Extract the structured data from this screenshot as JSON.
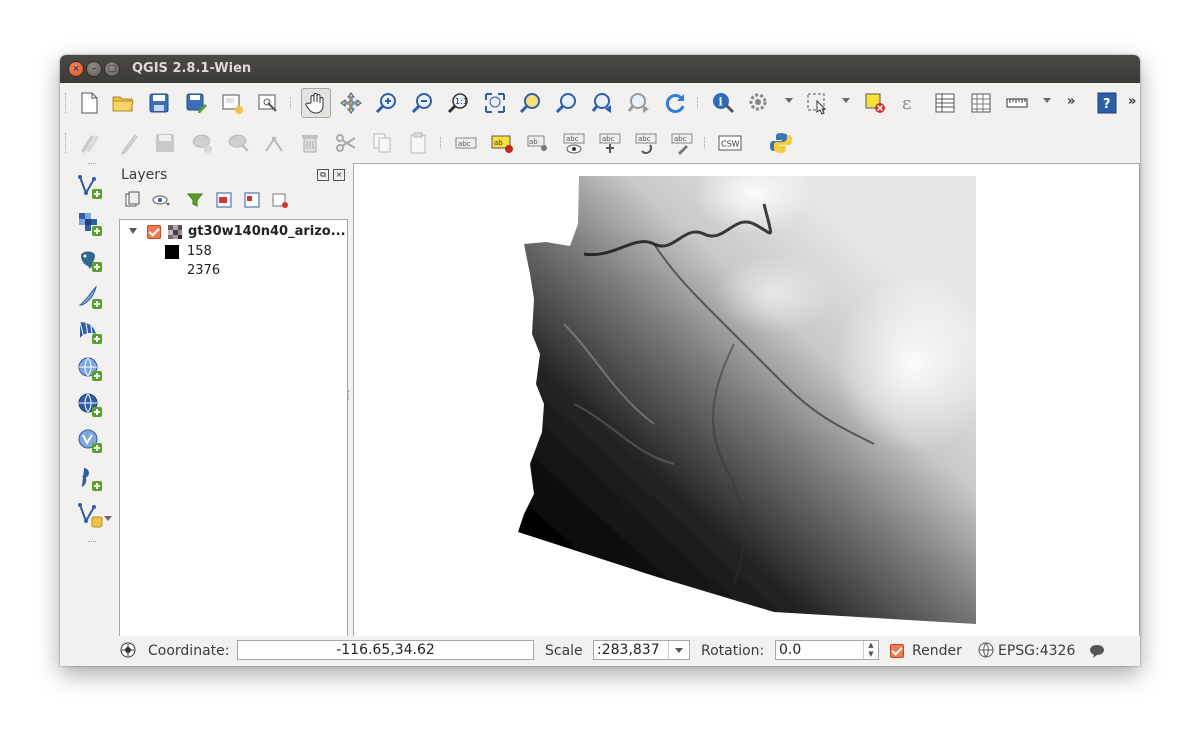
{
  "window": {
    "title": "QGIS 2.8.1-Wien"
  },
  "layers_panel": {
    "title": "Layers",
    "layer": {
      "name": "gt30w140n40_arizo...",
      "checked": true,
      "legend_min": "158",
      "legend_max": "2376"
    }
  },
  "status_bar": {
    "coordinate_label": "Coordinate:",
    "coordinate_value": "-116.65,34.62",
    "scale_label": "Scale",
    "scale_value": ":283,837",
    "rotation_label": "Rotation:",
    "rotation_value": "0.0",
    "render_label": "Render",
    "render_checked": true,
    "crs": "EPSG:4326"
  },
  "toolbar2": {
    "csw_label": "CSW",
    "label_abc": "abc"
  },
  "toolbar1": {
    "overflow": "»",
    "identify_help": "?"
  },
  "colors": {
    "accent_orange": "#f27a4e",
    "title_bar": "#3c3b37"
  }
}
